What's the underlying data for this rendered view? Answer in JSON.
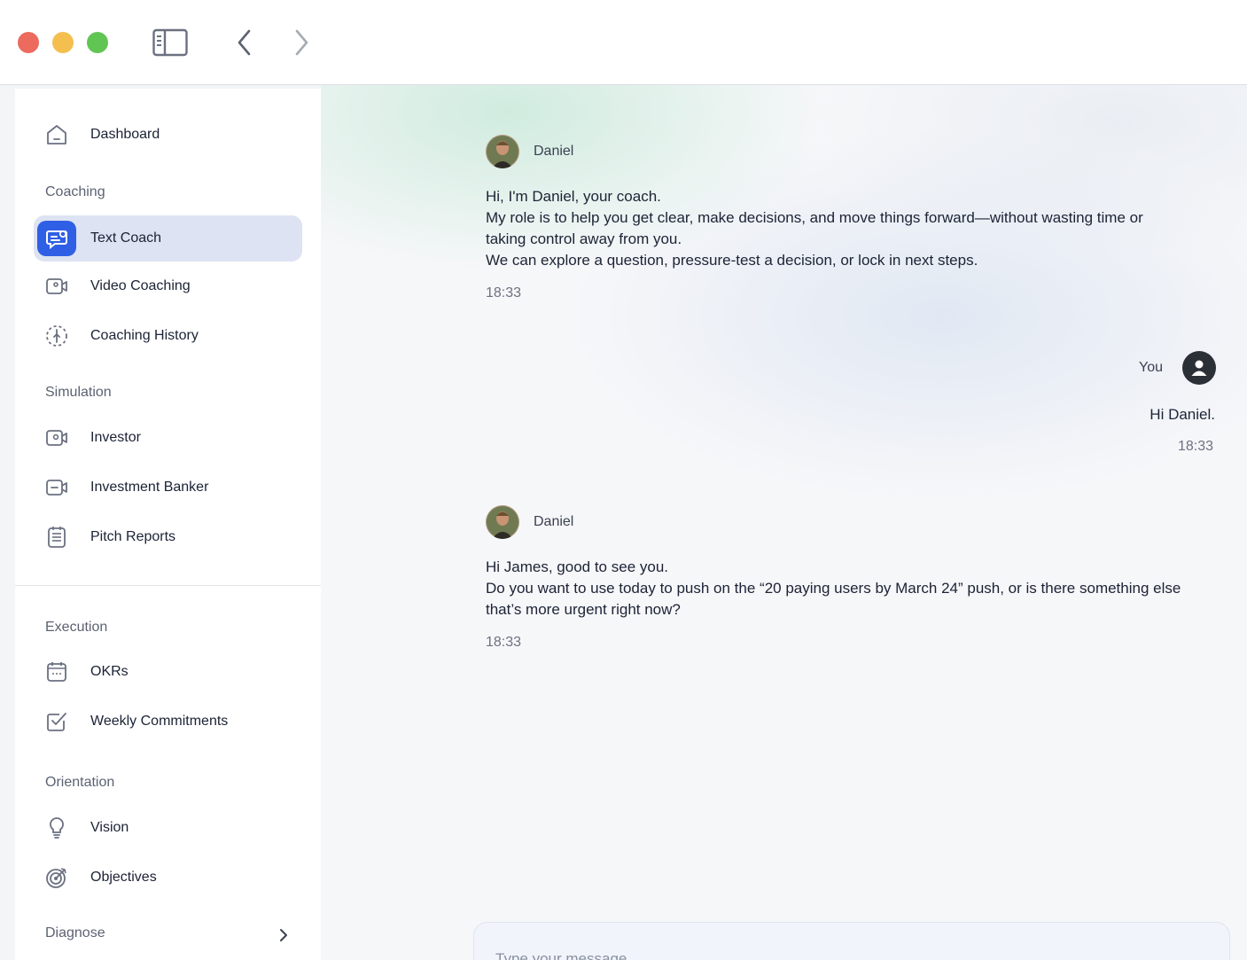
{
  "window": {
    "controls": [
      "close",
      "minimize",
      "zoom"
    ],
    "toolbar_icons": [
      "sidebar-toggle-icon",
      "back-chevron-icon",
      "forward-chevron-icon"
    ]
  },
  "sidebar": {
    "top_items": [
      {
        "label": "Dashboard",
        "icon": "home-icon"
      }
    ],
    "sections": [
      {
        "title": "Coaching",
        "items": [
          {
            "label": "Text Coach",
            "icon": "chat-coach-icon",
            "active": true
          },
          {
            "label": "Video Coaching",
            "icon": "video-camera-icon"
          },
          {
            "label": "Coaching History",
            "icon": "history-clock-icon"
          }
        ]
      },
      {
        "title": "Simulation",
        "items": [
          {
            "label": "Investor",
            "icon": "video-person-icon"
          },
          {
            "label": "Investment Banker",
            "icon": "video-minus-icon"
          },
          {
            "label": "Pitch Reports",
            "icon": "report-list-icon"
          }
        ]
      },
      {
        "title": "Execution",
        "items": [
          {
            "label": "OKRs",
            "icon": "calendar-icon"
          },
          {
            "label": "Weekly Commitments",
            "icon": "checkbox-icon"
          }
        ]
      },
      {
        "title": "Orientation",
        "items": [
          {
            "label": "Vision",
            "icon": "lightbulb-icon"
          },
          {
            "label": "Objectives",
            "icon": "target-icon"
          }
        ]
      },
      {
        "title": "Diagnose",
        "items": []
      }
    ]
  },
  "chat": {
    "messages": [
      {
        "sender": "Daniel",
        "role": "coach",
        "lines": [
          "Hi, I'm Daniel, your coach.",
          "My role is to help you get clear, make decisions, and move things forward—without wasting time or",
          "taking control away from you.",
          "We can explore a question, pressure-test a decision, or lock in next steps."
        ],
        "time": "18:33"
      },
      {
        "sender": "You",
        "role": "user",
        "lines": [
          "Hi Daniel."
        ],
        "time": "18:33"
      },
      {
        "sender": "Daniel",
        "role": "coach",
        "lines": [
          "Hi James, good to see you.",
          "Do you want to use today to push on the “20 paying users by March 24” push, or is there something else",
          "that’s more urgent right now?"
        ],
        "time": "18:33"
      }
    ],
    "composer": {
      "placeholder": "Type your message",
      "value": ""
    }
  },
  "colors": {
    "accent": "#2f5fe4",
    "active_bg": "#dde3f2"
  }
}
